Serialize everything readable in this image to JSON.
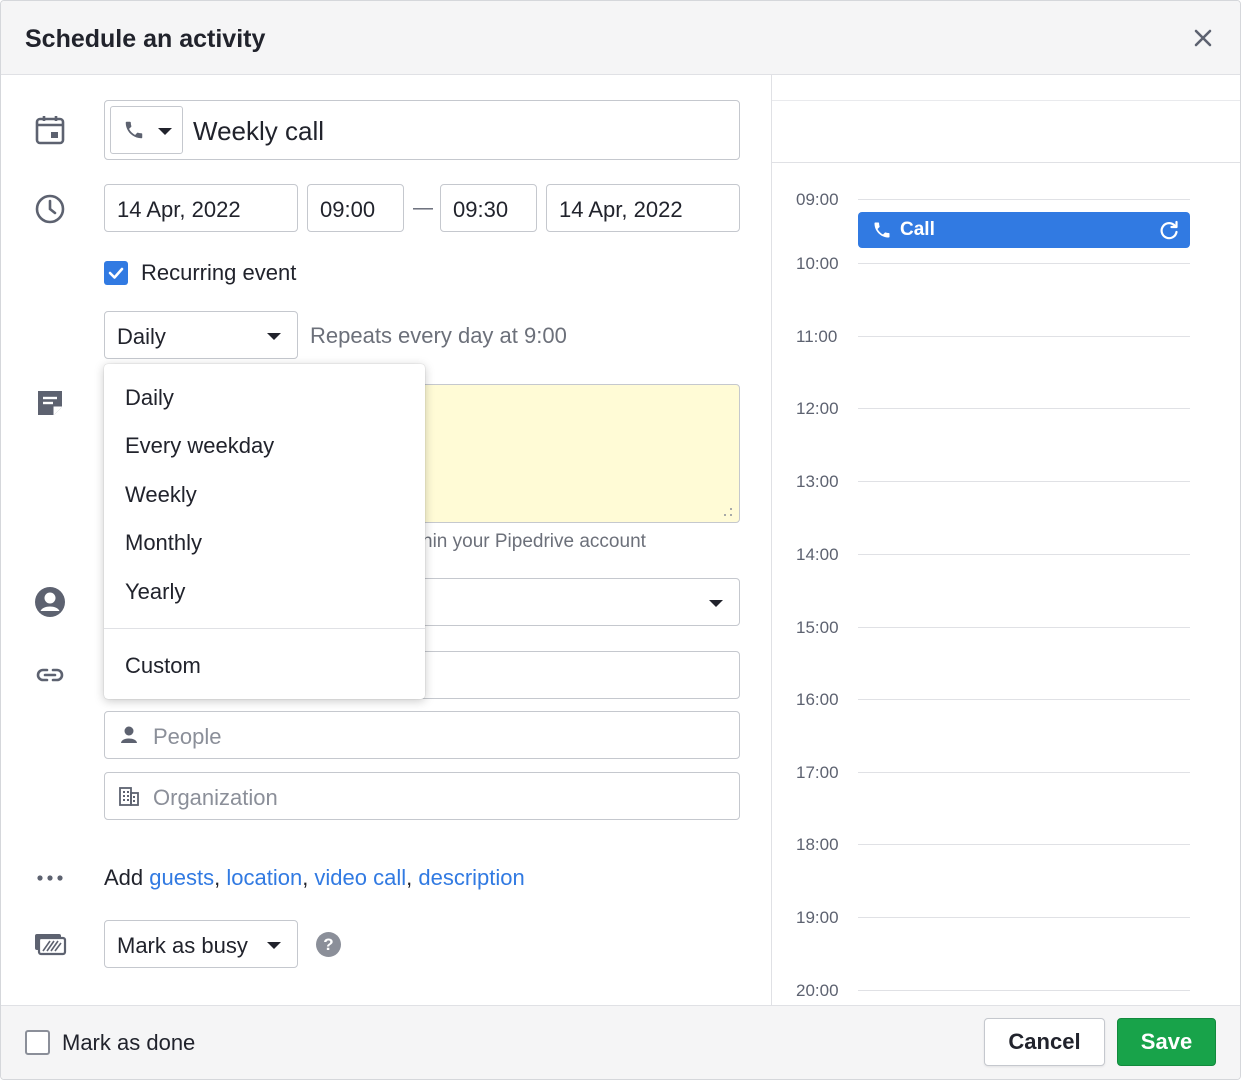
{
  "header": {
    "title": "Schedule an activity"
  },
  "subject": {
    "value": "Weekly call"
  },
  "datetime": {
    "start_date": "14 Apr, 2022",
    "start_time": "09:00",
    "separator": "—",
    "end_time": "09:30",
    "end_date": "14 Apr, 2022"
  },
  "recurring": {
    "label": "Recurring event",
    "checked": true
  },
  "frequency": {
    "selected": "Daily",
    "summary": "Repeats every day at 9:00"
  },
  "frequency_options": [
    "Daily",
    "Every weekday",
    "Weekly",
    "Monthly",
    "Yearly",
    "Custom"
  ],
  "note": {
    "hint": "hin your Pipedrive account"
  },
  "people": {
    "placeholder": "People"
  },
  "organization": {
    "placeholder": "Organization"
  },
  "add": {
    "prefix": "Add",
    "links": [
      "guests",
      "location",
      "video call",
      "description"
    ]
  },
  "busy": {
    "selected": "Mark as busy",
    "help": "?"
  },
  "footer": {
    "mark_done": "Mark as done",
    "cancel": "Cancel",
    "save": "Save"
  },
  "calendar": {
    "hours": [
      "09:00",
      "10:00",
      "11:00",
      "12:00",
      "13:00",
      "14:00",
      "15:00",
      "16:00",
      "17:00",
      "18:00",
      "19:00",
      "20:00"
    ],
    "event": {
      "label": "Call"
    }
  },
  "colors": {
    "accent": "#317ae2",
    "save": "#18a34a",
    "note_bg": "#fffbd6"
  }
}
